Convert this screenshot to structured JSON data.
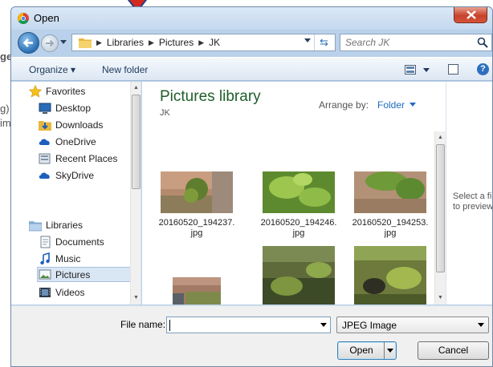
{
  "background": {
    "fragments": [
      "ge",
      "g)",
      "im"
    ]
  },
  "dialog": {
    "title": "Open",
    "address": {
      "crumbs": [
        "Libraries",
        "Pictures",
        "JK"
      ]
    },
    "search": {
      "placeholder": "Search JK"
    },
    "toolbar": {
      "organize_label": "Organize",
      "new_folder_label": "New folder"
    },
    "navpane": {
      "favorites_label": "Favorites",
      "favorites": [
        "Desktop",
        "Downloads",
        "OneDrive",
        "Recent Places",
        "SkyDrive"
      ],
      "libraries_label": "Libraries",
      "libraries": [
        "Documents",
        "Music",
        "Pictures",
        "Videos"
      ],
      "selected": "Pictures"
    },
    "content": {
      "library_title": "Pictures library",
      "library_subtitle": "JK",
      "arrange_label": "Arrange by:",
      "arrange_value": "Folder",
      "files": [
        {
          "name_line1": "20160520_194237.",
          "name_line2": "jpg"
        },
        {
          "name_line1": "20160520_194246.",
          "name_line2": "jpg"
        },
        {
          "name_line1": "20160520_194253.",
          "name_line2": "jpg"
        }
      ]
    },
    "preview": {
      "text_line1": "Select a fil",
      "text_line2": "to preview"
    },
    "bottom": {
      "file_name_label": "File name:",
      "file_name_value": "",
      "file_type": "JPEG Image",
      "open_label": "Open",
      "cancel_label": "Cancel"
    }
  },
  "icons": [
    "chrome-icon",
    "close-icon",
    "back-arrow-icon",
    "forward-arrow-icon",
    "folder-icon",
    "refresh-icon",
    "search-icon",
    "view-options-icon",
    "preview-pane-icon",
    "help-icon",
    "star-icon",
    "desktop-icon",
    "downloads-icon",
    "cloud-icon",
    "recent-places-icon",
    "libraries-icon",
    "documents-icon",
    "music-icon",
    "pictures-icon",
    "videos-icon"
  ]
}
